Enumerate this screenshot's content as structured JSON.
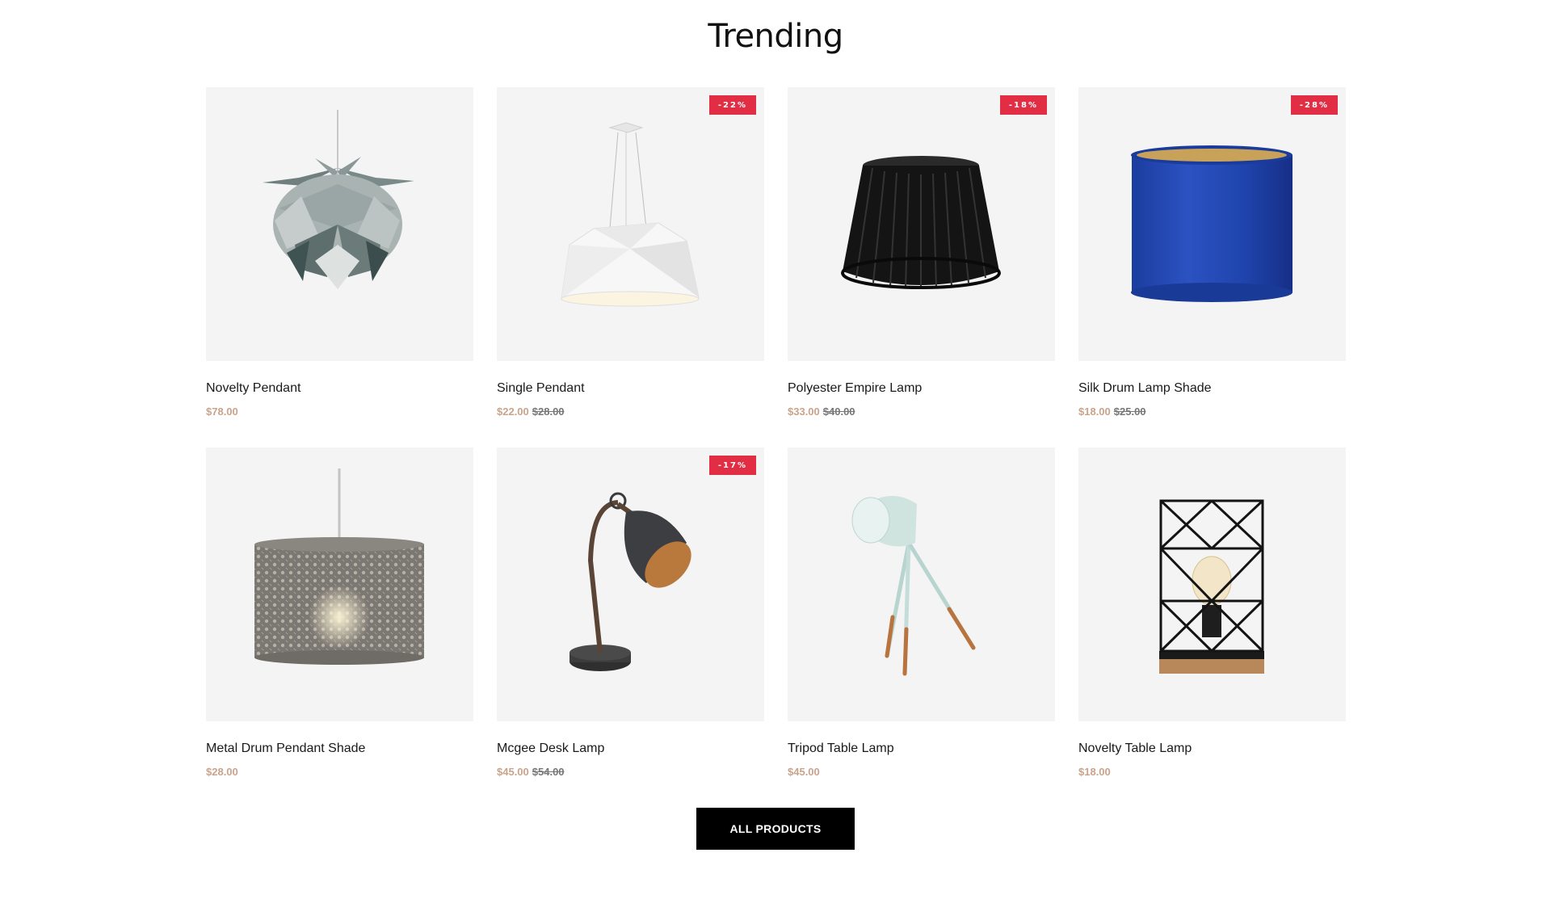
{
  "section": {
    "title": "Trending"
  },
  "products": [
    {
      "name": "Novelty Pendant",
      "price": "$78.00",
      "old_price": "",
      "badge": "",
      "image": "pinecone-pendant-image"
    },
    {
      "name": "Single Pendant",
      "price": "$22.00",
      "old_price": "$28.00",
      "badge": "-22%",
      "image": "geometric-pendant-image"
    },
    {
      "name": "Polyester Empire Lamp",
      "price": "$33.00",
      "old_price": "$40.00",
      "badge": "-18%",
      "image": "black-empire-shade-image"
    },
    {
      "name": "Silk Drum Lamp Shade",
      "price": "$18.00",
      "old_price": "$25.00",
      "badge": "-28%",
      "image": "blue-drum-shade-image"
    },
    {
      "name": "Metal Drum Pendant Shade",
      "price": "$28.00",
      "old_price": "",
      "badge": "",
      "image": "metal-drum-pendant-image"
    },
    {
      "name": "Mcgee Desk Lamp",
      "price": "$45.00",
      "old_price": "$54.00",
      "badge": "-17%",
      "image": "desk-lamp-image"
    },
    {
      "name": "Tripod Table Lamp",
      "price": "$45.00",
      "old_price": "",
      "badge": "",
      "image": "tripod-lamp-image"
    },
    {
      "name": "Novelty Table Lamp",
      "price": "$18.00",
      "old_price": "",
      "badge": "",
      "image": "wire-cage-lamp-image"
    }
  ],
  "cta": {
    "label": "ALL PRODUCTS"
  },
  "colors": {
    "badge": "#e12e44",
    "price": "#c9a38c",
    "old_price": "#777777",
    "button": "#000000",
    "thumb_bg": "#f4f4f4"
  }
}
